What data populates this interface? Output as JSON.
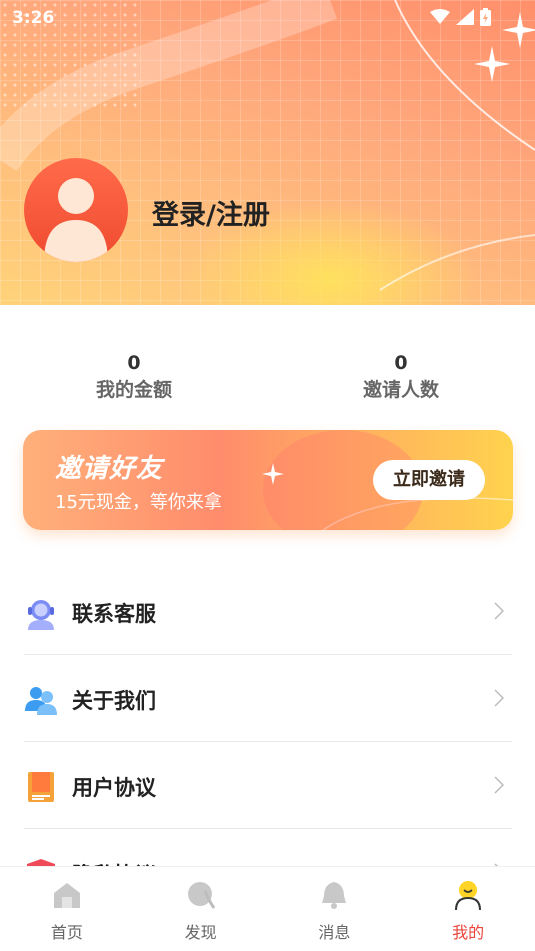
{
  "status_bar": {
    "time": "3:26"
  },
  "profile": {
    "login_label": "登录/注册"
  },
  "stats": [
    {
      "value": "0",
      "label": "我的金额"
    },
    {
      "value": "0",
      "label": "邀请人数"
    }
  ],
  "invite_banner": {
    "title": "邀请好友",
    "subtitle": "15元现金，等你来拿",
    "button_label": "立即邀请"
  },
  "menu": {
    "items": [
      {
        "label": "联系客服",
        "icon": "headset-icon"
      },
      {
        "label": "关于我们",
        "icon": "users-icon"
      },
      {
        "label": "用户协议",
        "icon": "book-icon"
      },
      {
        "label": "隐私协议",
        "icon": "shield-icon"
      }
    ]
  },
  "tabbar": {
    "tabs": [
      {
        "label": "首页",
        "icon": "home-icon"
      },
      {
        "label": "发现",
        "icon": "discover-icon"
      },
      {
        "label": "消息",
        "icon": "bell-icon"
      },
      {
        "label": "我的",
        "icon": "profile-icon",
        "active": true
      }
    ]
  },
  "colors": {
    "accent": "#e8453c",
    "header_start": "#ff8f6a",
    "header_end": "#ffd37a",
    "avatar": "#ef4a2f"
  }
}
